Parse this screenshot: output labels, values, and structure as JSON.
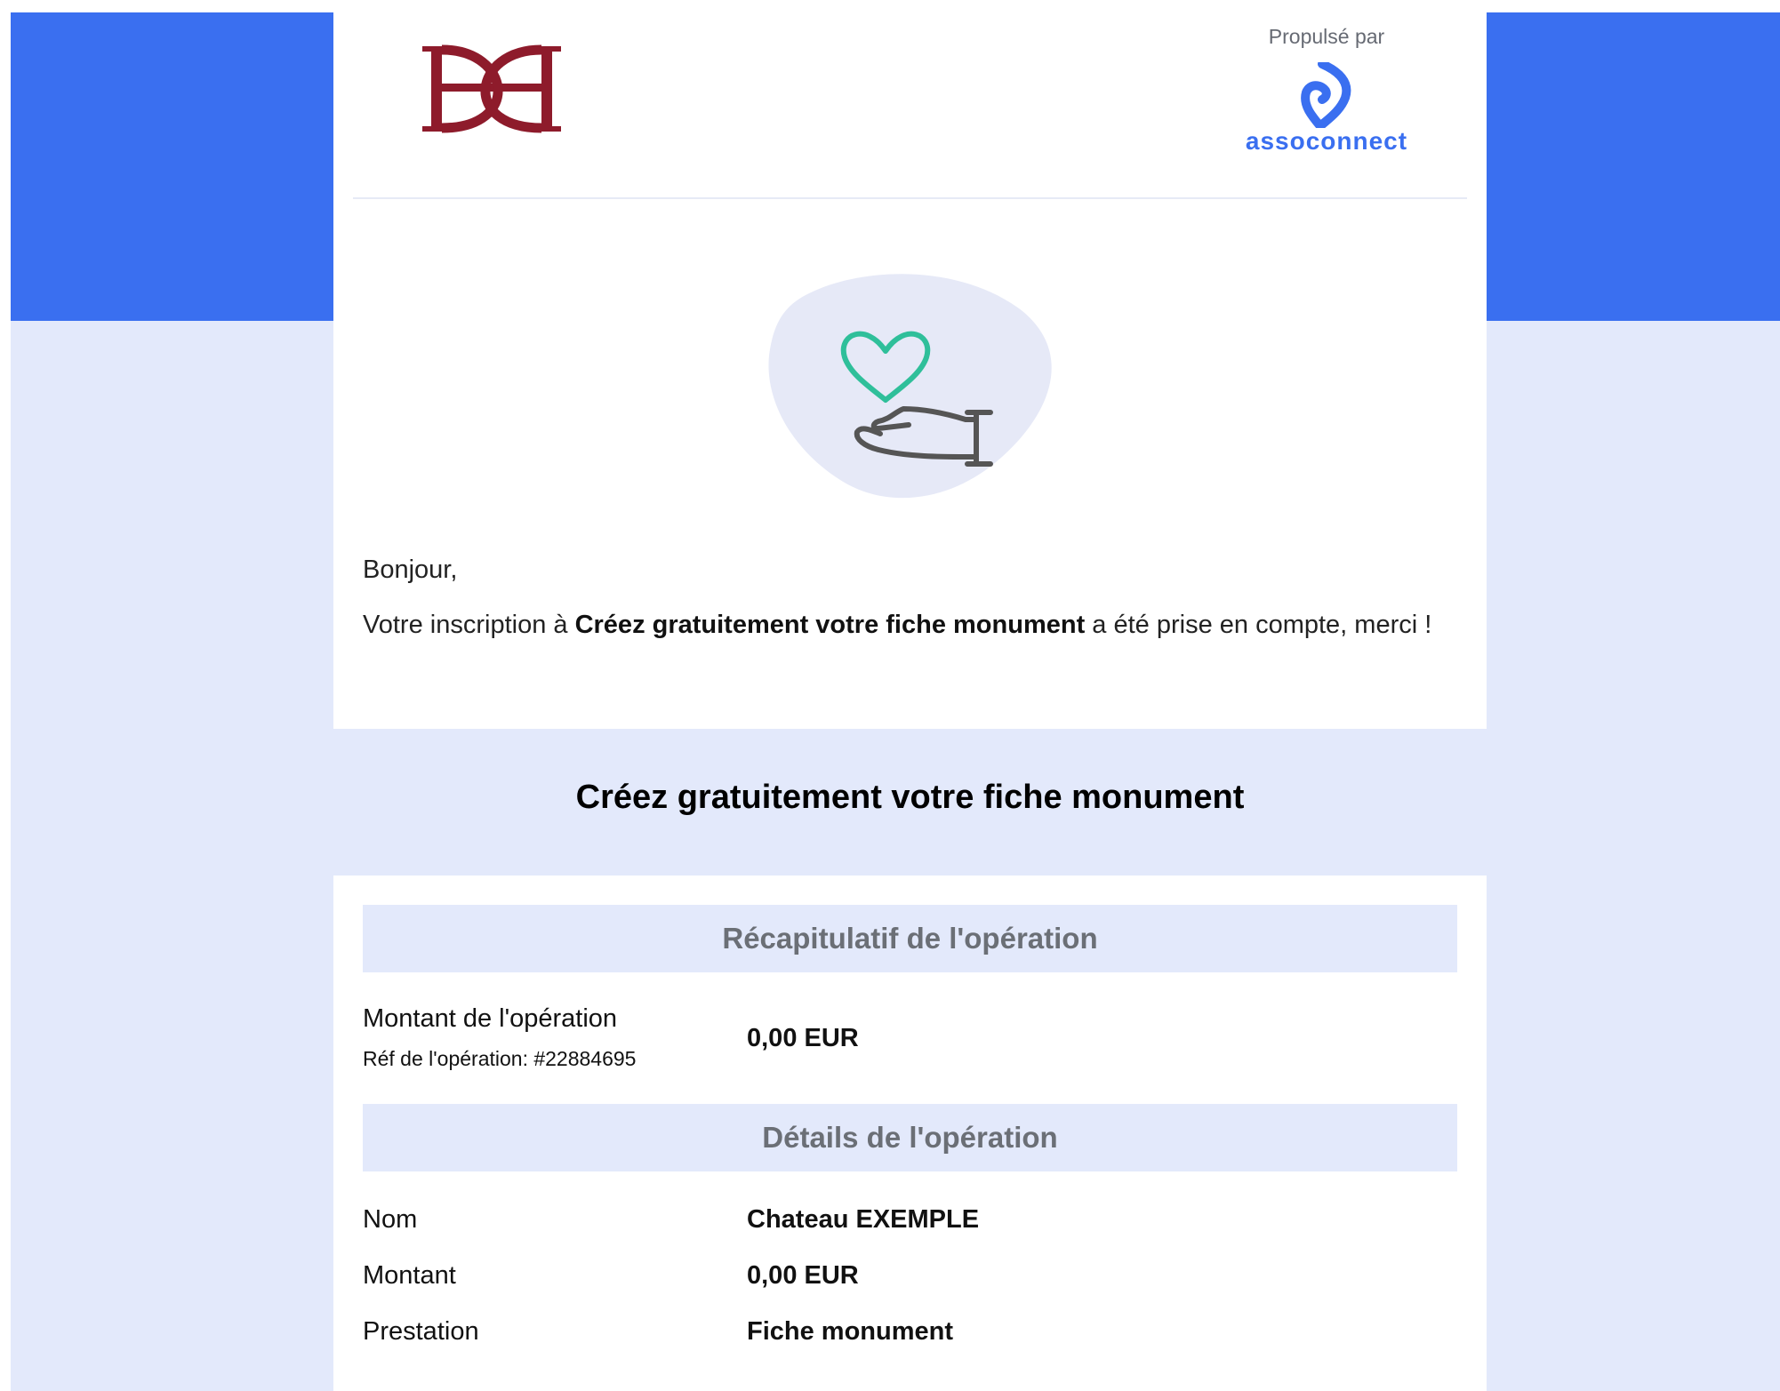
{
  "header": {
    "powered_by_label": "Propulsé par",
    "brand_name": "assoconnect",
    "brand_color": "#3a6ff0",
    "org_logo_color": "#8e1b2b"
  },
  "hero": {
    "icon": "heart-in-hand-icon",
    "heart_color": "#2fbf9a",
    "hand_color": "#555555"
  },
  "message": {
    "greeting": "Bonjour,",
    "line_prefix": "Votre inscription à ",
    "event_name": "Créez gratuitement votre fiche monument",
    "line_suffix": " a été prise en compte, merci !"
  },
  "section": {
    "title": "Créez gratuitement votre fiche monument"
  },
  "recap": {
    "heading": "Récapitulatif de l'opération",
    "amount_label": "Montant de l'opération",
    "reference_label": "Réf de l'opération: #22884695",
    "amount_value": "0,00 EUR"
  },
  "details": {
    "heading": "Détails de l'opération",
    "rows": [
      {
        "label": "Nom",
        "value": "Chateau EXEMPLE"
      },
      {
        "label": "Montant",
        "value": "0,00 EUR"
      },
      {
        "label": "Prestation",
        "value": "Fiche monument"
      }
    ]
  }
}
